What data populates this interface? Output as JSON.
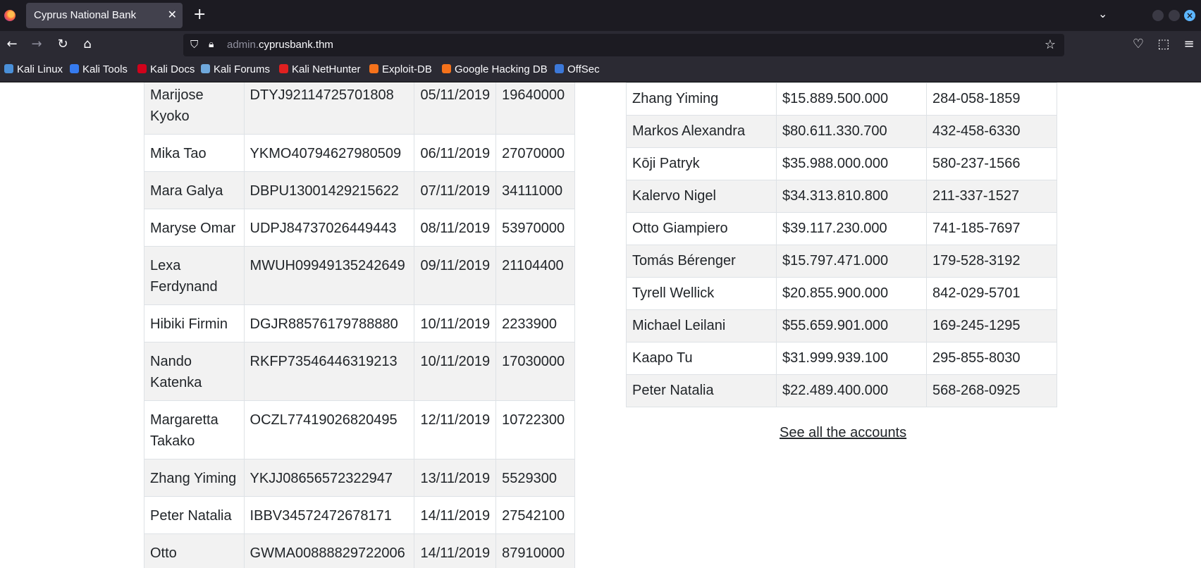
{
  "browser": {
    "tab_title": "Cyprus National Bank",
    "tab_close": "✕",
    "new_tab": "+",
    "url_prefix": "admin.",
    "url_host": "cyprusbank.thm"
  },
  "bookmarks": [
    {
      "label": "Kali Linux",
      "icon_color": "#4a90d9"
    },
    {
      "label": "Kali Tools",
      "icon_color": "#367bf0"
    },
    {
      "label": "Kali Docs",
      "icon_color": "#d0021b"
    },
    {
      "label": "Kali Forums",
      "icon_color": "#6fa8dc"
    },
    {
      "label": "Kali NetHunter",
      "icon_color": "#e02020"
    },
    {
      "label": "Exploit-DB",
      "icon_color": "#f5721b"
    },
    {
      "label": "Google Hacking DB",
      "icon_color": "#f5721b"
    },
    {
      "label": "OffSec",
      "icon_color": "#3c78d8"
    }
  ],
  "left_table": {
    "rows": [
      [
        "Marijose Kyoko",
        "DTYJ92114725701808",
        "05/11/2019",
        "19640000"
      ],
      [
        "Mika Tao",
        "YKMO40794627980509",
        "06/11/2019",
        "27070000"
      ],
      [
        "Mara Galya",
        "DBPU13001429215622",
        "07/11/2019",
        "34111000"
      ],
      [
        "Maryse Omar",
        "UDPJ84737026449443",
        "08/11/2019",
        "53970000"
      ],
      [
        "Lexa Ferdynand",
        "MWUH09949135242649",
        "09/11/2019",
        "21104400"
      ],
      [
        "Hibiki Firmin",
        "DGJR88576179788880",
        "10/11/2019",
        "2233900"
      ],
      [
        "Nando Katenka",
        "RKFP73546446319213",
        "10/11/2019",
        "17030000"
      ],
      [
        "Margaretta Takako",
        "OCZL77419026820495",
        "12/11/2019",
        "10722300"
      ],
      [
        "Zhang Yiming",
        "YKJJ08656572322947",
        "13/11/2019",
        "5529300"
      ],
      [
        "Peter Natalia",
        "IBBV34572472678171",
        "14/11/2019",
        "27542100"
      ],
      [
        "Otto Giampiero",
        "GWMA00888829722006",
        "14/11/2019",
        "87910000"
      ]
    ]
  },
  "right_table": {
    "rows": [
      [
        "Zhang Yiming",
        "$15.889.500.000",
        "284-058-1859"
      ],
      [
        "Markos Alexandra",
        "$80.611.330.700",
        "432-458-6330"
      ],
      [
        "Kōji Patryk",
        "$35.988.000.000",
        "580-237-1566"
      ],
      [
        "Kalervo Nigel",
        "$34.313.810.800",
        "211-337-1527"
      ],
      [
        "Otto Giampiero",
        "$39.117.230.000",
        "741-185-7697"
      ],
      [
        "Tomás Bérenger",
        "$15.797.471.000",
        "179-528-3192"
      ],
      [
        "Tyrell Wellick",
        "$20.855.900.000",
        "842-029-5701"
      ],
      [
        "Michael Leilani",
        "$55.659.901.000",
        "169-245-1295"
      ],
      [
        "Kaapo Tu",
        "$31.999.939.100",
        "295-855-8030"
      ],
      [
        "Peter Natalia",
        "$22.489.400.000",
        "568-268-0925"
      ]
    ]
  },
  "see_all_link": "See all the accounts"
}
